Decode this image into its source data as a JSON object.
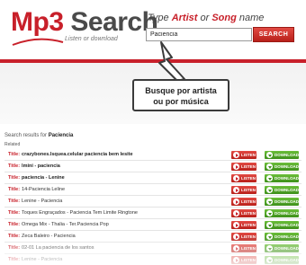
{
  "header": {
    "logo_brand_1": "Mp3",
    "logo_brand_2": " Search",
    "logo_tagline": "Listen or download",
    "prompt_part1": "Type ",
    "prompt_artist": "Artist",
    "prompt_or": " or ",
    "prompt_song": "Song",
    "prompt_part2": " name",
    "search_value": "Paciencia",
    "search_button": "SEARCH"
  },
  "callout": {
    "line1": "Busque por artista",
    "line2": "ou por música"
  },
  "results": {
    "prefix": "Search results for ",
    "query": "Paciencia",
    "related": "Related",
    "title_label": "Title:",
    "listen_label": "LISTEN",
    "download_label": "DOWNLOAD",
    "items": [
      {
        "title": "crazybones.lsquea.celular paciencia bem lesite"
      },
      {
        "title": "lmini - paciencia"
      },
      {
        "title": "paciencia - Lenine"
      },
      {
        "title": "14-Paciencia Leline"
      },
      {
        "title": "Lenine - Paciencia"
      },
      {
        "title": "Toques Engraçados - Paciencia Tem Limite Ringtone"
      },
      {
        "title": "Omega Mix - Thalia - Ter.Paciencia Pop"
      },
      {
        "title": "Zeca Baleiro - Paciencia"
      },
      {
        "title": "02-01 La paciencia de los santos"
      },
      {
        "title": "Lenine - Paciencia"
      }
    ]
  },
  "colors": {
    "brand_red": "#c8202a",
    "listen_red": "#d13a33",
    "download_green": "#52a82a"
  }
}
